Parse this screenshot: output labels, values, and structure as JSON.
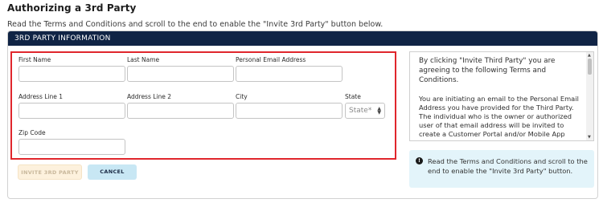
{
  "page": {
    "title": "Authorizing a 3rd Party",
    "intro": "Read the Terms and Conditions and scroll to the end to enable the \"Invite 3rd Party\" button below."
  },
  "card": {
    "header": "3RD PARTY INFORMATION"
  },
  "form": {
    "first_name": {
      "label": "First Name",
      "value": ""
    },
    "last_name": {
      "label": "Last Name",
      "value": ""
    },
    "email": {
      "label": "Personal Email Address",
      "value": ""
    },
    "address1": {
      "label": "Address Line 1",
      "value": ""
    },
    "address2": {
      "label": "Address Line 2",
      "value": ""
    },
    "city": {
      "label": "City",
      "value": ""
    },
    "state": {
      "label": "State",
      "placeholder": "State*"
    },
    "zip": {
      "label": "Zip Code",
      "value": ""
    }
  },
  "buttons": {
    "invite_label": "INVITE 3RD PARTY",
    "cancel_label": "CANCEL"
  },
  "terms": {
    "heading": "By clicking \"Invite Third Party\" you are agreeing to the following Terms and Conditions.",
    "body": "You are initiating an email to the Personal Email Address you have provided for the Third Party. The individual who is the owner or authorized user of that email address will be invited to create a Customer Portal and/or Mobile App account login and password that will give them access to your account"
  },
  "info": {
    "text": "Read the Terms and Conditions and scroll to the end to enable the \"Invite 3rd Party\" button."
  },
  "colors": {
    "header_bg": "#102445",
    "highlight_border": "#e0262c",
    "cancel_bg": "#c8e7f4",
    "invite_bg": "#fdf1dd",
    "info_bg": "#e3f4fa"
  }
}
